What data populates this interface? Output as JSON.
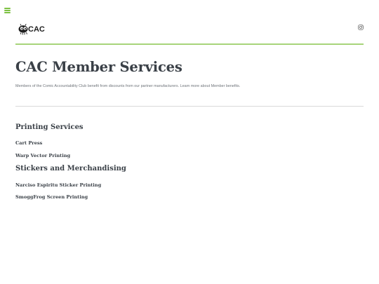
{
  "header": {
    "logo_text": "CAC",
    "menu_icon": "hamburger-menu-icon",
    "social_icon": "instagram-icon",
    "accent_color": "#7dc142"
  },
  "main": {
    "title": "CAC Member Services",
    "intro": "Members of the Comic Accountability Club benefit from discounts from our partner manufacturers. Learn more about Member benefits.",
    "sections": [
      {
        "heading": "Printing Services",
        "links": [
          "Cart Press",
          "Warp Vector Printing"
        ]
      },
      {
        "heading": "Stickers and Merchandising",
        "links": [
          "Narciso Espiritu Sticker Printing",
          "SmoggFrog Screen Printing"
        ]
      }
    ]
  }
}
